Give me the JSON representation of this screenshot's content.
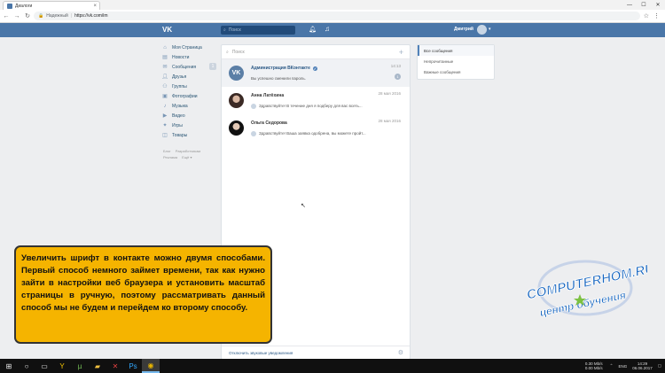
{
  "browser": {
    "tab_title": "Диалоги",
    "tab_close": "×",
    "win_min": "—",
    "win_max": "☐",
    "win_close": "✕",
    "secure_label": "Надежный",
    "url": "https://vk.com/im"
  },
  "header": {
    "logo": "VK",
    "search_placeholder": "Поиск",
    "username": "Дмитрий"
  },
  "left_menu": {
    "items": [
      {
        "label": "Моя Страница",
        "icon": "home-icon"
      },
      {
        "label": "Новости",
        "icon": "news-icon"
      },
      {
        "label": "Сообщения",
        "icon": "messages-icon",
        "badge": "1"
      },
      {
        "label": "Друзья",
        "icon": "friends-icon"
      },
      {
        "label": "Группы",
        "icon": "groups-icon"
      },
      {
        "label": "Фотографии",
        "icon": "photos-icon"
      },
      {
        "label": "Музыка",
        "icon": "music-icon"
      },
      {
        "label": "Видео",
        "icon": "video-icon"
      },
      {
        "label": "Игры",
        "icon": "games-icon"
      },
      {
        "label": "Товары",
        "icon": "goods-icon"
      }
    ],
    "footer": [
      "Блог",
      "Разработчикам",
      "Реклама",
      "Ещё ▾"
    ]
  },
  "dialogs": {
    "search_placeholder": "Поиск",
    "rows": [
      {
        "name": "Администрация ВКонтакте",
        "verified": true,
        "message": "Вы успешно сменили пароль.",
        "time": "14:13",
        "unread": "1",
        "active": true
      },
      {
        "name": "Анна Латёхина",
        "message": "Здравствуйте! В течение дня я подберу для вас всеть...",
        "time": "28 мая 2016"
      },
      {
        "name": "Ольга Седорова",
        "message": "Здравствуйте! Ваша заявка одобрена, вы можете пройт...",
        "time": "28 мая 2016"
      }
    ],
    "footer_label": "Отключить звуковые уведомления"
  },
  "filters": {
    "items": [
      "Все сообщения",
      "Непрочитанные",
      "Важные сообщения"
    ]
  },
  "overlay": {
    "text": "Увеличить шрифт в контакте можно двумя способами. Первый способ немного займет времени, так как нужно зайти в настройки веб браузера и установить масштаб страницы в ручную, поэтому рассматривать данный способ мы не будем и перейдем ко второму способу."
  },
  "watermark": {
    "line1": "COMPUTERHOM.RU",
    "line2": "центр обучения"
  },
  "taskbar": {
    "speed_up": "0.30 Mb/s",
    "speed_down": "0.00 Mb/s",
    "lang": "ENG",
    "time": "14:29",
    "date": "06.06.2017"
  },
  "colors": {
    "vk_blue": "#4a76a8",
    "overlay_bg": "#f5b400"
  }
}
